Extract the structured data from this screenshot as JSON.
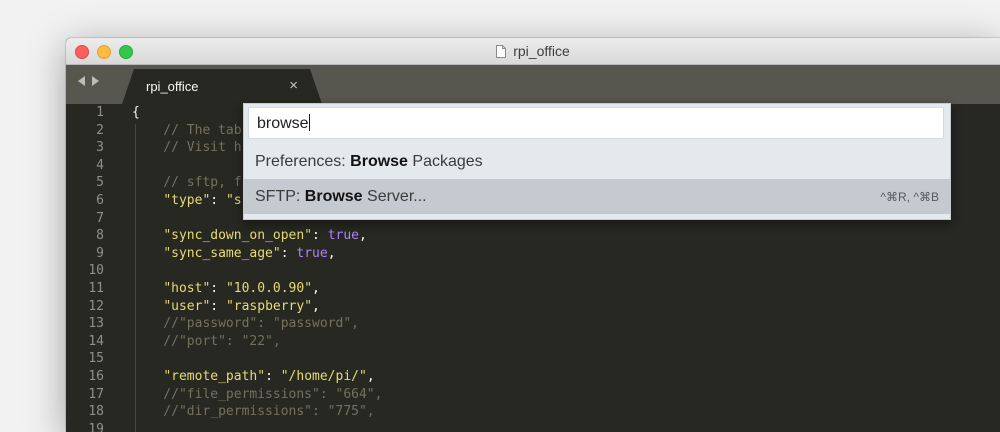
{
  "window": {
    "title": "rpi_office",
    "tab_label": "rpi_office",
    "tab_close": "×"
  },
  "gutter": {
    "line_numbers": [
      "1",
      "2",
      "3",
      "4",
      "5",
      "6",
      "7",
      "8",
      "9",
      "10",
      "11",
      "12",
      "13",
      "14",
      "15",
      "16",
      "17",
      "18",
      "19"
    ]
  },
  "code_lines": [
    {
      "n": "1",
      "segments": [
        {
          "t": "{",
          "c": "pun"
        }
      ]
    },
    {
      "n": "2",
      "segments": [
        {
          "t": "    // The tab",
          "c": "cm"
        }
      ]
    },
    {
      "n": "3",
      "segments": [
        {
          "t": "    // Visit h",
          "c": "cm"
        }
      ]
    },
    {
      "n": "4",
      "segments": []
    },
    {
      "n": "5",
      "segments": [
        {
          "t": "    // sftp, f",
          "c": "cm"
        }
      ]
    },
    {
      "n": "6",
      "segments": [
        {
          "t": "    ",
          "c": "pun"
        },
        {
          "t": "\"type\"",
          "c": "str"
        },
        {
          "t": ": ",
          "c": "pun"
        },
        {
          "t": "\"s",
          "c": "str"
        }
      ]
    },
    {
      "n": "7",
      "segments": []
    },
    {
      "n": "8",
      "segments": [
        {
          "t": "    ",
          "c": "pun"
        },
        {
          "t": "\"sync_down_on_open\"",
          "c": "str"
        },
        {
          "t": ": ",
          "c": "pun"
        },
        {
          "t": "true",
          "c": "kw"
        },
        {
          "t": ",",
          "c": "pun"
        }
      ]
    },
    {
      "n": "9",
      "segments": [
        {
          "t": "    ",
          "c": "pun"
        },
        {
          "t": "\"sync_same_age\"",
          "c": "str"
        },
        {
          "t": ": ",
          "c": "pun"
        },
        {
          "t": "true",
          "c": "kw"
        },
        {
          "t": ",",
          "c": "pun"
        }
      ]
    },
    {
      "n": "10",
      "segments": []
    },
    {
      "n": "11",
      "segments": [
        {
          "t": "    ",
          "c": "pun"
        },
        {
          "t": "\"host\"",
          "c": "str"
        },
        {
          "t": ": ",
          "c": "pun"
        },
        {
          "t": "\"10.0.0.90\"",
          "c": "str"
        },
        {
          "t": ",",
          "c": "pun"
        }
      ]
    },
    {
      "n": "12",
      "segments": [
        {
          "t": "    ",
          "c": "pun"
        },
        {
          "t": "\"user\"",
          "c": "str"
        },
        {
          "t": ": ",
          "c": "pun"
        },
        {
          "t": "\"raspberry\"",
          "c": "str"
        },
        {
          "t": ",",
          "c": "pun"
        }
      ]
    },
    {
      "n": "13",
      "segments": [
        {
          "t": "    //\"password\": \"password\",",
          "c": "cm"
        }
      ]
    },
    {
      "n": "14",
      "segments": [
        {
          "t": "    //\"port\": \"22\",",
          "c": "cm"
        }
      ]
    },
    {
      "n": "15",
      "segments": []
    },
    {
      "n": "16",
      "segments": [
        {
          "t": "    ",
          "c": "pun"
        },
        {
          "t": "\"remote_path\"",
          "c": "str"
        },
        {
          "t": ": ",
          "c": "pun"
        },
        {
          "t": "\"/home/pi/\"",
          "c": "str"
        },
        {
          "t": ",",
          "c": "pun"
        }
      ]
    },
    {
      "n": "17",
      "segments": [
        {
          "t": "    //\"file_permissions\": \"664\",",
          "c": "cm"
        }
      ]
    },
    {
      "n": "18",
      "segments": [
        {
          "t": "    //\"dir_permissions\": \"775\",",
          "c": "cm"
        }
      ]
    },
    {
      "n": "19",
      "segments": []
    }
  ],
  "palette": {
    "query": "browse",
    "items": [
      {
        "prefix": "Preferences: ",
        "match": "Browse",
        "suffix": " Packages",
        "shortcut": ""
      },
      {
        "prefix": "SFTP: ",
        "match": "Browse",
        "suffix": " Server...",
        "shortcut": "^⌘R, ^⌘B"
      }
    ]
  },
  "icons": {
    "document": "document-icon",
    "nav_back": "back-arrow-icon",
    "nav_forward": "forward-arrow-icon"
  },
  "colors": {
    "editor_bg": "#272822",
    "comment": "#75715e",
    "string": "#e6db74",
    "constant": "#ae81ff",
    "tabbar_bg": "#57574f",
    "palette_bg": "#e4e9ee",
    "palette_selected": "#c5cad0"
  }
}
